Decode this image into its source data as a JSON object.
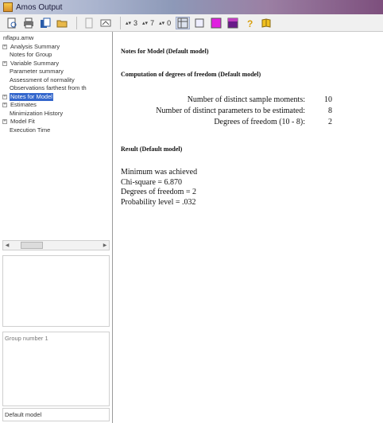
{
  "window": {
    "title": "Amos Output"
  },
  "toolbar": {
    "icons": [
      "print-preview-icon",
      "print-icon",
      "copy-icon",
      "open-icon",
      "page-icon",
      "options-icon"
    ],
    "spin1": "3",
    "spin2": "7",
    "spin3": "0",
    "colors": {
      "magenta": "#e020e0",
      "purple": "#6a1b8a",
      "yellow": "#f0c020"
    }
  },
  "tree": {
    "items": [
      {
        "label": "nflapu.amw",
        "level": 0,
        "expander": "",
        "selected": false
      },
      {
        "label": "Analysis Summary",
        "level": 0,
        "expander": "+",
        "selected": false
      },
      {
        "label": "Notes for Group",
        "level": 1,
        "expander": "",
        "selected": false
      },
      {
        "label": "Variable Summary",
        "level": 0,
        "expander": "+",
        "selected": false
      },
      {
        "label": "Parameter summary",
        "level": 1,
        "expander": "",
        "selected": false
      },
      {
        "label": "Assessment of normality",
        "level": 1,
        "expander": "",
        "selected": false
      },
      {
        "label": "Observations farthest from th",
        "level": 1,
        "expander": "",
        "selected": false
      },
      {
        "label": "Notes for Model",
        "level": 0,
        "expander": "+",
        "selected": true
      },
      {
        "label": "Estimates",
        "level": 0,
        "expander": "+",
        "selected": false
      },
      {
        "label": "Minimization History",
        "level": 1,
        "expander": "",
        "selected": false
      },
      {
        "label": "Model Fit",
        "level": 0,
        "expander": "+",
        "selected": false
      },
      {
        "label": "Execution Time",
        "level": 1,
        "expander": "",
        "selected": false
      }
    ]
  },
  "panes": {
    "group": "Group number 1",
    "model": "Default model"
  },
  "content": {
    "heading_notes": "Notes for Model (Default model)",
    "heading_computation": "Computation of degrees of freedom (Default model)",
    "df_rows": [
      {
        "label": "Number of distinct sample moments:",
        "value": "10"
      },
      {
        "label": "Number of distinct parameters to be estimated:",
        "value": "8"
      },
      {
        "label": "Degrees of freedom (10 - 8):",
        "value": "2"
      }
    ],
    "heading_result": "Result (Default model)",
    "result_lines": [
      "Minimum was achieved",
      "Chi-square = 6.870",
      "Degrees of freedom = 2",
      "Probability level = .032"
    ]
  }
}
